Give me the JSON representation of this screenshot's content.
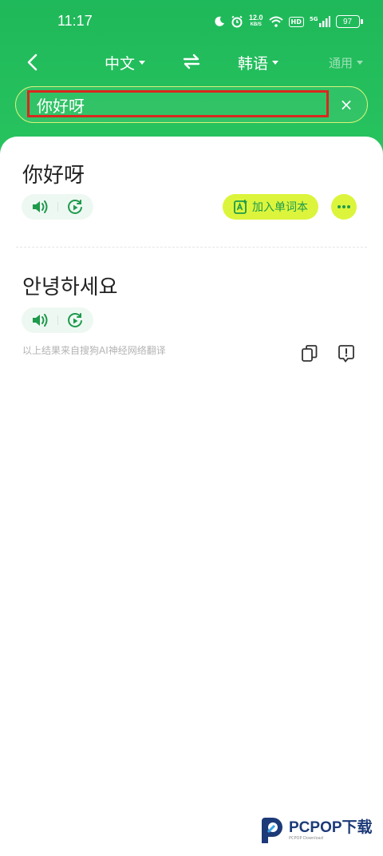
{
  "status_bar": {
    "time": "11:17",
    "net_speed": "12.0",
    "net_speed_unit": "KB/S",
    "hd": "HD",
    "signal_type": "5G",
    "battery": "97"
  },
  "nav": {
    "source_lang": "中文",
    "target_lang": "韩语",
    "domain": "通用"
  },
  "search": {
    "query": "你好呀"
  },
  "result": {
    "source_text": "你好呀",
    "translation": "안녕하세요",
    "add_wordbook_label": "加入单词本",
    "engine_note": "以上结果来自搜狗AI神经网络翻译"
  },
  "watermark": {
    "brand": "PCPOP下载",
    "sub": "PCPOP Download"
  },
  "colors": {
    "header_green": "#22bd5c",
    "accent_lime": "#dcf53c",
    "highlight_red": "#d9281e",
    "icon_green": "#1e9a4c"
  }
}
